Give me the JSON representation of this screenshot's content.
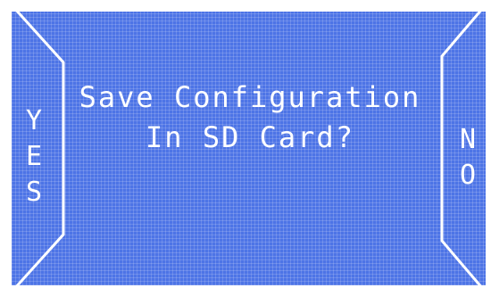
{
  "dialog": {
    "prompt_line_1": "Save Configuration",
    "prompt_line_2": "In SD Card?",
    "yes_letters": [
      "Y",
      "E",
      "S"
    ],
    "no_letters": [
      "N",
      "O"
    ]
  },
  "colors": {
    "screen_background": "#4d74e6",
    "foreground": "#ffffff"
  }
}
